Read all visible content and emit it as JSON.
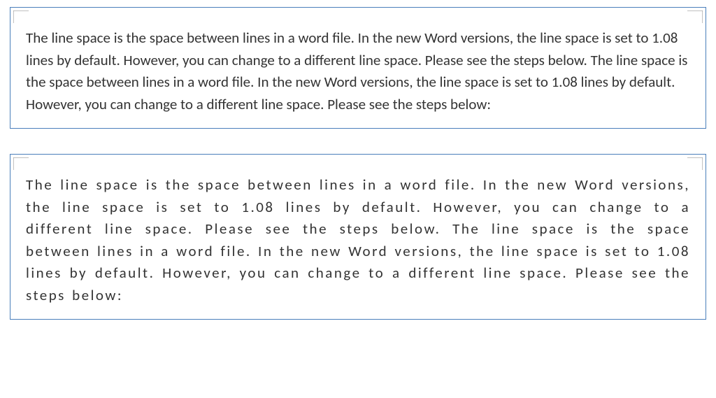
{
  "box1": {
    "text": "The line space is the space between lines in a word file. In the new Word versions, the line space is set to 1.08 lines by default. However, you can change to a different line space. Please see the steps below. The line space is the space between lines in a word file. In the new Word versions, the line space is set to 1.08 lines by default. However, you can change to a different line space. Please see the steps below:"
  },
  "box2": {
    "text": "The line space is the space between lines in a word file. In the new Word versions, the line space is set to 1.08 lines by default. However, you can change to a different line space. Please see the steps below. The line space is the space between lines in a word file. In the new Word versions, the line space is set to 1.08 lines by default. However, you can change to a different line space. Please see the steps below:"
  }
}
